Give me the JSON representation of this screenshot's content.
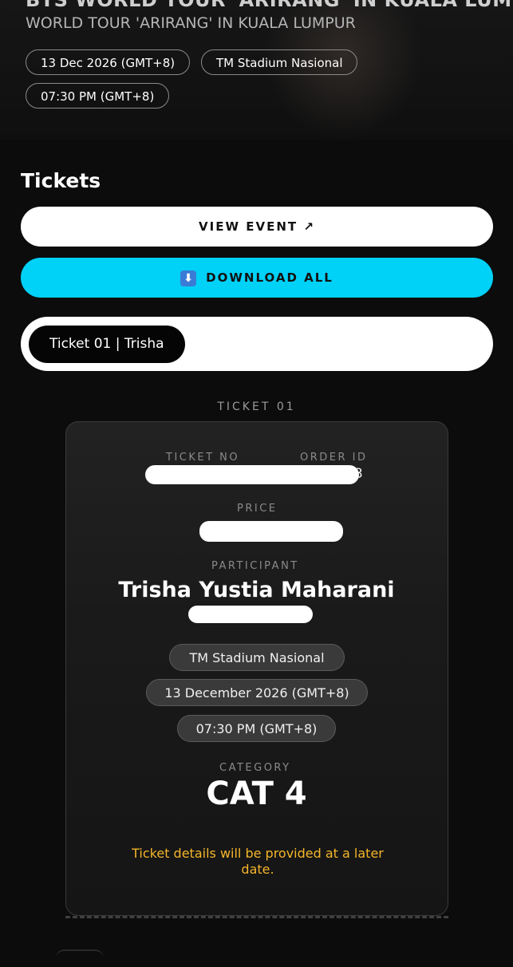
{
  "event": {
    "title": "BTS WORLD TOUR 'ARIRANG' IN KUALA LUMPUR",
    "subtitle": "WORLD TOUR 'ARIRANG' IN KUALA LUMPUR",
    "date": "13 Dec 2026 (GMT+8)",
    "venue": "TM Stadium Nasional",
    "time": "07:30 PM (GMT+8)"
  },
  "tickets_section": {
    "title": "Tickets",
    "view_event_label": "VIEW EVENT ↗",
    "download_icon": "⬇",
    "download_all_label": "DOWNLOAD ALL",
    "tabs": [
      {
        "label": "Ticket 01 | Trisha",
        "active": true
      }
    ]
  },
  "ticket": {
    "heading": "TICKET 01",
    "ticket_no_label": "TICKET NO",
    "order_id_label": "ORDER ID",
    "order_id_visible_suffix": "3",
    "price_label": "PRICE",
    "participant_label": "PARTICIPANT",
    "participant_name": "Trisha Yustia Maharani",
    "venue": "TM Stadium Nasional",
    "date": "13 December 2026 (GMT+8)",
    "time": "07:30 PM (GMT+8)",
    "category_label": "CATEGORY",
    "category_value": "CAT 4",
    "note": "Ticket details will be provided at a later date."
  },
  "colors": {
    "background": "#0c0c0c",
    "download_button": "#00d1f7",
    "note_text": "#f5b52a",
    "redaction": "#ffffff"
  }
}
